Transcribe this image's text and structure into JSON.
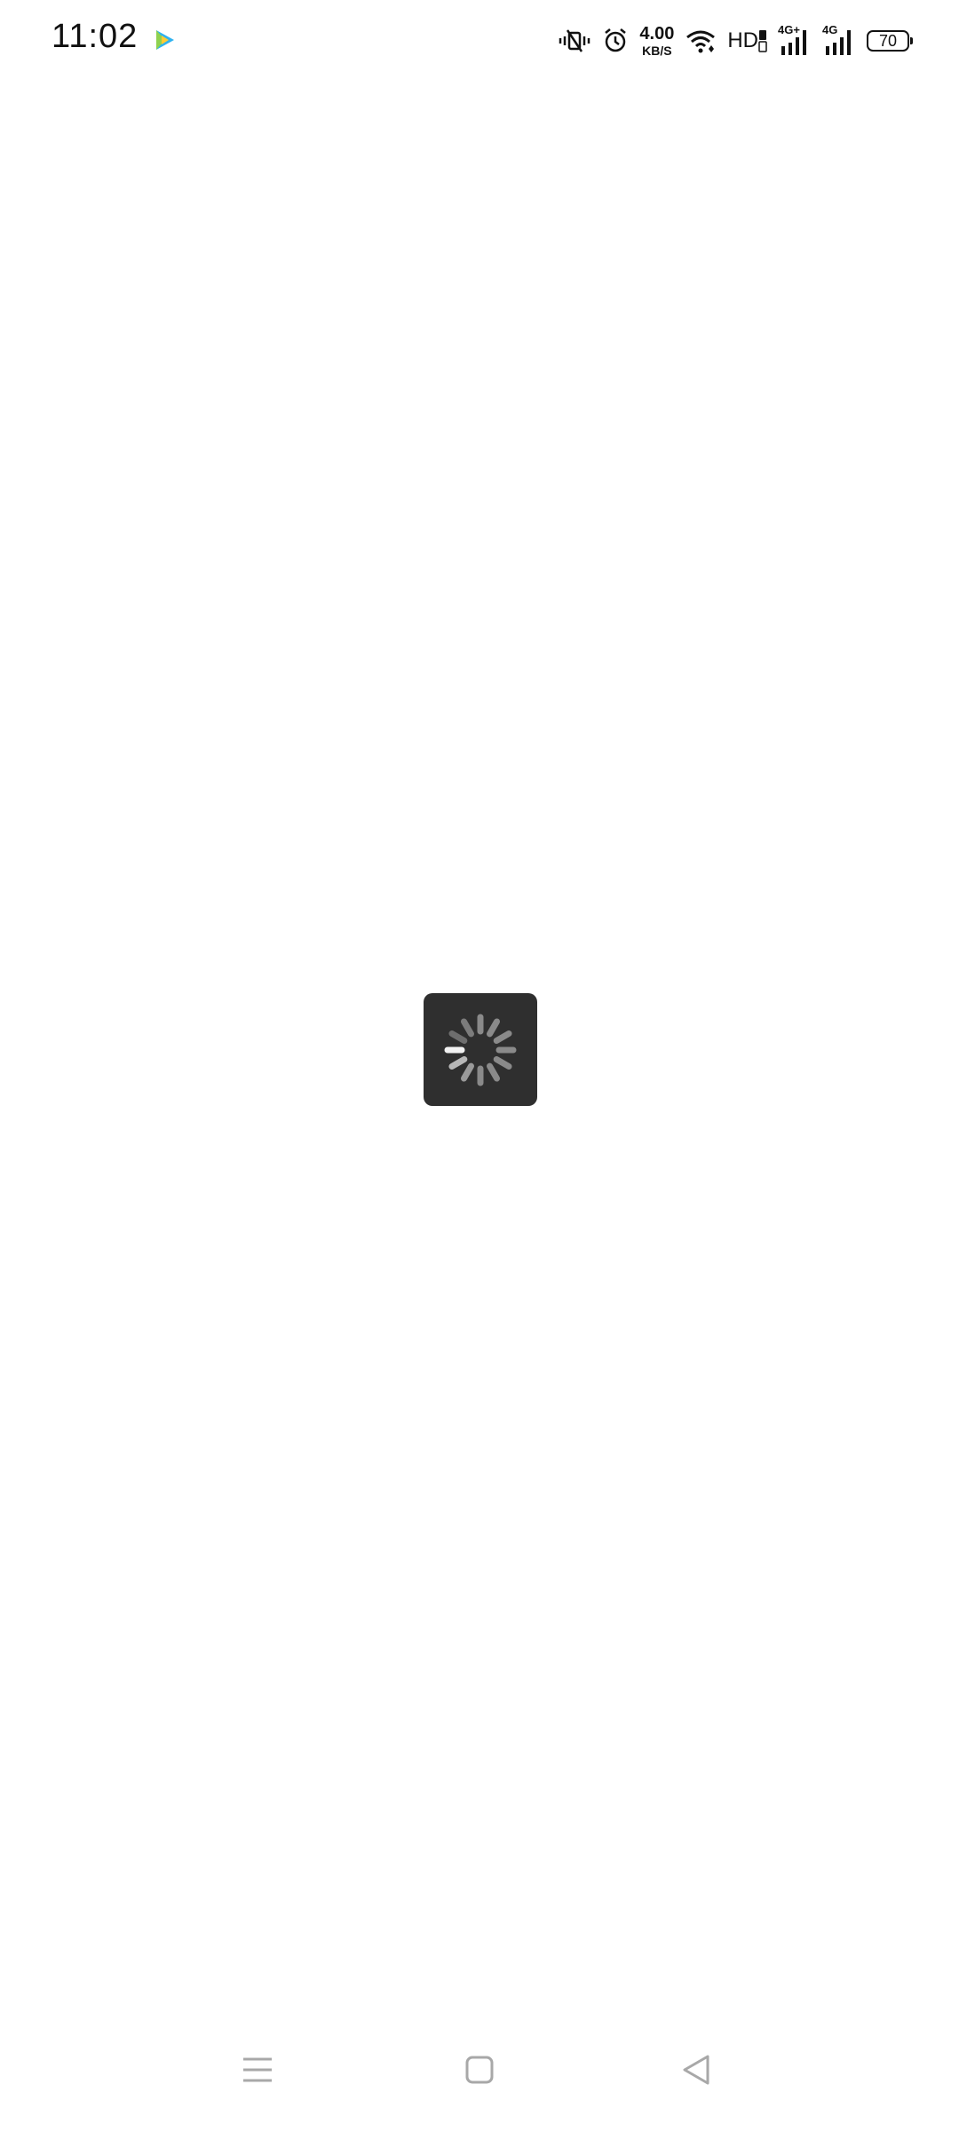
{
  "status_bar": {
    "time": "11:02",
    "network_speed_value": "4.00",
    "network_speed_unit": "KB/S",
    "hd_label": "HD",
    "sim1_type": "4G+",
    "sim2_type": "4G",
    "battery_level": "70",
    "icons": [
      "video-app-notification-icon",
      "vibrate-mode-icon",
      "alarm-icon",
      "wifi-icon",
      "hd-volte-icon",
      "signal-icon",
      "signal-icon",
      "battery-icon"
    ]
  },
  "loading": {
    "indicator": "spinner-icon"
  },
  "nav_bar": {
    "icons": [
      "menu-icon",
      "home-icon",
      "back-icon"
    ]
  }
}
